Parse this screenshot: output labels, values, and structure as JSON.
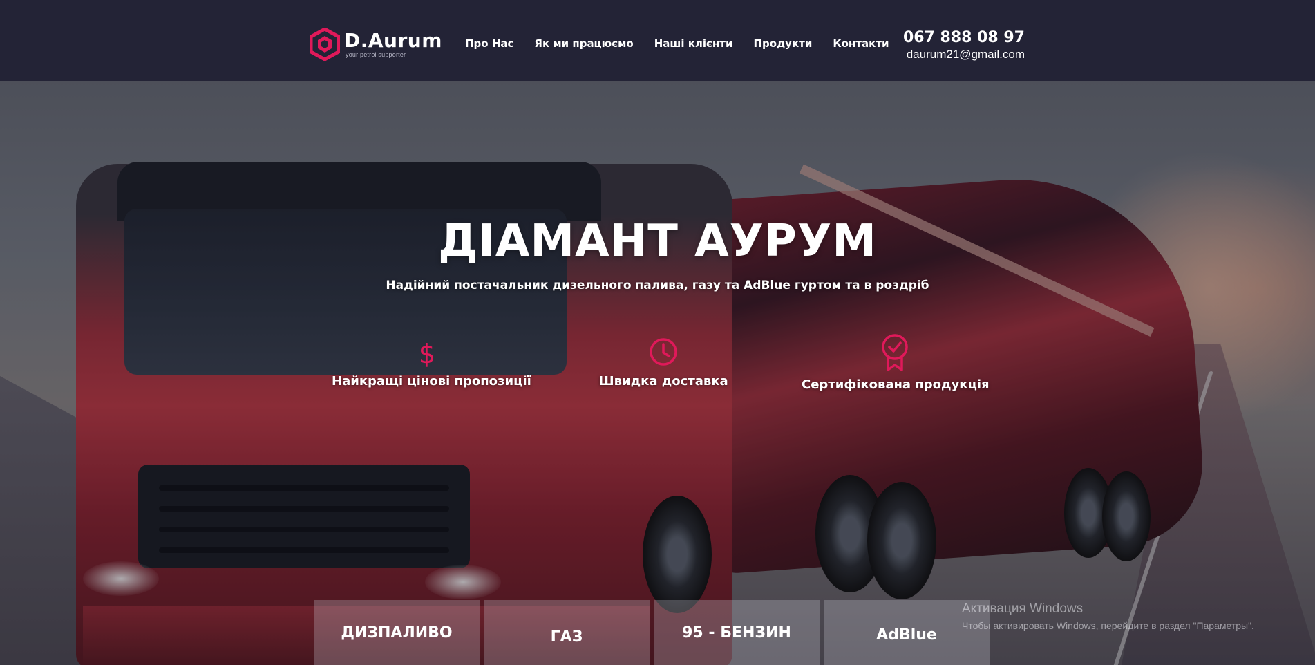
{
  "brand": {
    "name": "D.Aurum",
    "tagline": "your petrol supporter",
    "accent_color": "#e0195a"
  },
  "nav": {
    "items": [
      {
        "label": "Про Нас"
      },
      {
        "label": "Як ми працюємо"
      },
      {
        "label": "Наші клієнти"
      },
      {
        "label": "Продукти"
      },
      {
        "label": "Контакти"
      }
    ]
  },
  "contact": {
    "phone": "067 888 08 97",
    "email": "daurum21@gmail.com"
  },
  "hero": {
    "title": "ДІАМАНТ АУРУМ",
    "subtitle": "Надійний постачальник дизельного палива, газу та AdBlue гуртом та в роздріб"
  },
  "features": [
    {
      "icon": "dollar-icon",
      "label": "Найкращі цінові пропозиції"
    },
    {
      "icon": "clock-icon",
      "label": "Швидка доставка"
    },
    {
      "icon": "certificate-badge-icon",
      "label": "Сертифікована продукція"
    }
  ],
  "products": {
    "tabs": [
      {
        "label": "ДИЗПАЛИВО"
      },
      {
        "label": "ГАЗ"
      },
      {
        "label": "95 - БЕНЗИН"
      },
      {
        "label": "AdBlue"
      }
    ]
  },
  "os_watermark": {
    "title": "Активация Windows",
    "subtitle": "Чтобы активировать Windows, перейдите в раздел \"Параметры\"."
  }
}
